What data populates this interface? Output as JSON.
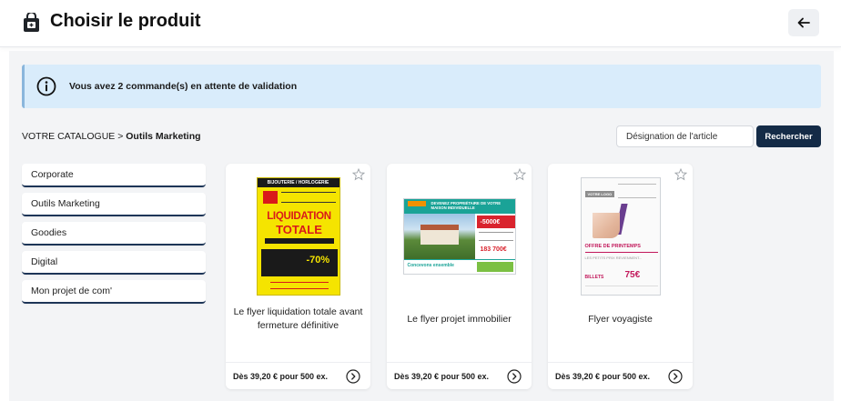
{
  "header": {
    "title": "Choisir le produit",
    "bag_icon": "shopping-bag-icon",
    "back_icon": "arrow-left-icon"
  },
  "alert": {
    "icon": "info-icon",
    "text": "Vous avez 2 commande(s) en attente de validation"
  },
  "breadcrumb": {
    "root": "VOTRE CATALOGUE",
    "separator": " > ",
    "current": "Outils Marketing"
  },
  "search": {
    "placeholder": "Désignation de l'article",
    "value": "",
    "button_label": "Rechercher"
  },
  "sidebar": {
    "items": [
      {
        "label": "Corporate"
      },
      {
        "label": "Outils Marketing"
      },
      {
        "label": "Goodies"
      },
      {
        "label": "Digital"
      },
      {
        "label": "Mon projet de com'"
      }
    ]
  },
  "products": [
    {
      "name": "Le flyer liquidation totale avant fermeture définitive",
      "price": "Dès 39,20 € pour 500 ex.",
      "thumb": {
        "top": "BIJOUTERIE / HORLOGERIE",
        "big1": "LIQUIDATION",
        "big2": "TOTALE",
        "promo": "-70%"
      }
    },
    {
      "name": "Le flyer projet immobilier",
      "price": "Dès 39,20 € pour 500 ex.",
      "thumb": {
        "headline": "DEVENEZ PROPRIÉTAIRE DE VOTRE MAISON INDIVIDUELLE",
        "offer": "-5000€",
        "price": "183 700€",
        "footer": "Concevons ensemble"
      }
    },
    {
      "name": "Flyer voyagiste",
      "price": "Dès 39,20 € pour 500 ex.",
      "thumb": {
        "logo": "VOTRE LOGO",
        "offer": "OFFRE DE PRINTEMPS",
        "sub": "LES PETITS PRIX REVIENNENT...",
        "tickets": "BILLETS",
        "price": "75€"
      }
    }
  ],
  "colors": {
    "accent": "#142b47",
    "alert_bg": "#d9ecfb",
    "promo_yellow": "#f5e400",
    "promo_red": "#d91a1a"
  }
}
